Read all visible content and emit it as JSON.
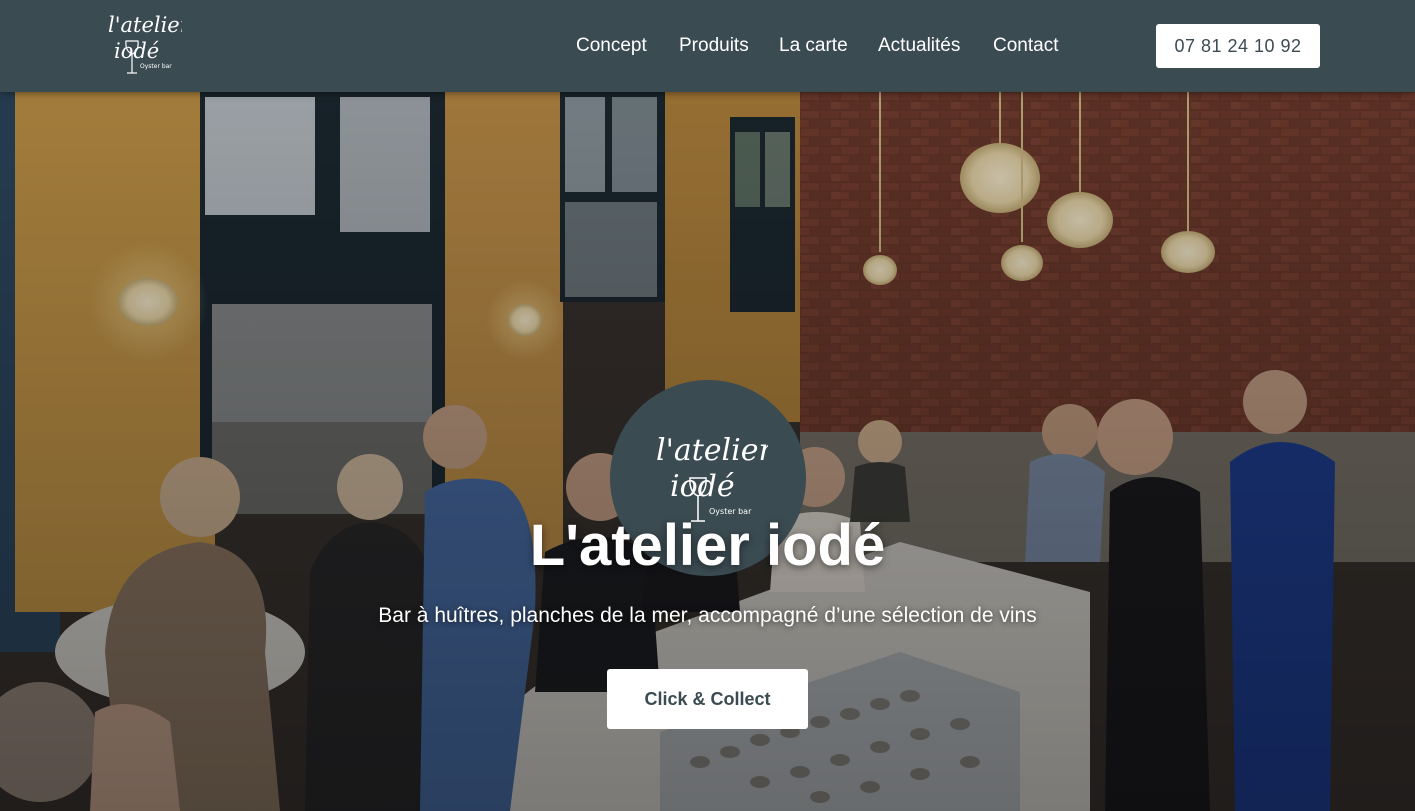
{
  "header": {
    "logo": {
      "line1": "l'atelier",
      "line2": "iodé",
      "tagline": "Oyster bar"
    },
    "nav": [
      {
        "label": "Concept"
      },
      {
        "label": "Produits"
      },
      {
        "label": "La carte"
      },
      {
        "label": "Actualités"
      },
      {
        "label": "Contact"
      }
    ],
    "phone": "07 81 24 10 92"
  },
  "hero": {
    "title": "L'atelier iodé",
    "subtitle": "Bar à huîtres, planches de la mer, accompagné d’une sélection de vins",
    "cta_label": "Click & Collect"
  },
  "colors": {
    "brand": "#3b4b52",
    "white": "#ffffff"
  }
}
